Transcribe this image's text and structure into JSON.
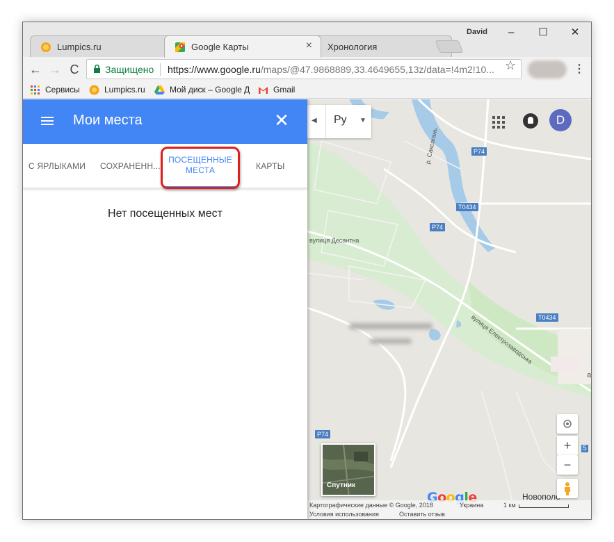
{
  "window": {
    "user": "David",
    "controls": {
      "minimize": "–",
      "maximize": "☐",
      "close": "✕"
    }
  },
  "tabs": [
    {
      "label": "Lumpics.ru",
      "icon": "orange-icon",
      "close": "×"
    },
    {
      "label": "Google Карты",
      "icon": "google-maps-icon",
      "close": "×"
    },
    {
      "label": "Хронология",
      "icon": "google-maps-icon",
      "close": "×"
    }
  ],
  "toolbar": {
    "back": "←",
    "forward": "→",
    "reload": "C",
    "secure_label": "Защищено",
    "url_scheme": "https://",
    "url_domain": "www.google.ru",
    "url_path": "/maps/@47.9868889,33.4649655,13z/data=!4m2!10...",
    "star": "☆",
    "menu": "⋮"
  },
  "bookmarks": [
    {
      "label": "Сервисы",
      "icon": "apps-grid-icon"
    },
    {
      "label": "Lumpics.ru",
      "icon": "orange-icon"
    },
    {
      "label": "Мой диск – Google Д",
      "icon": "google-drive-icon"
    },
    {
      "label": "Gmail",
      "icon": "gmail-icon"
    }
  ],
  "panel": {
    "title": "Мои места",
    "close": "✕",
    "tabs": [
      {
        "label": "С ЯРЛЫКАМИ",
        "active": false
      },
      {
        "label": "СОХРАНЕНН...",
        "active": false
      },
      {
        "label": "ПОСЕЩЕННЫЕ МЕСТА",
        "line1": "ПОСЕЩЕННЫЕ",
        "line2": "МЕСТА",
        "active": true
      },
      {
        "label": "КАРТЫ",
        "active": false
      }
    ],
    "empty_message": "Нет посещенных мест"
  },
  "map": {
    "language_value": "Ру",
    "avatar_letter": "D",
    "zoom_in": "+",
    "zoom_out": "−",
    "satellite_label": "Спутник",
    "google_logo": "Google",
    "road_labels": [
      "P74",
      "T0434",
      "P74",
      "T0434",
      "P74"
    ],
    "street_labels": [
      "вулиця Десантна",
      "вулиця Електрозаводська",
      "р. Саксагань",
      "Новополе",
      "а",
      "5"
    ],
    "footer": {
      "copyright": "Картографические данные © Google, 2018",
      "country": "Украина",
      "scale": "1 км",
      "terms": "Условия использования",
      "feedback": "Оставить отзыв"
    },
    "colors": {
      "land": "#e8e6e1",
      "green": "#cfe8c4",
      "water": "#a6cbe8",
      "road_badge": "#4a7fc1"
    }
  },
  "accent": {
    "header": "#4285f4",
    "highlight": "#dd1f1f"
  }
}
